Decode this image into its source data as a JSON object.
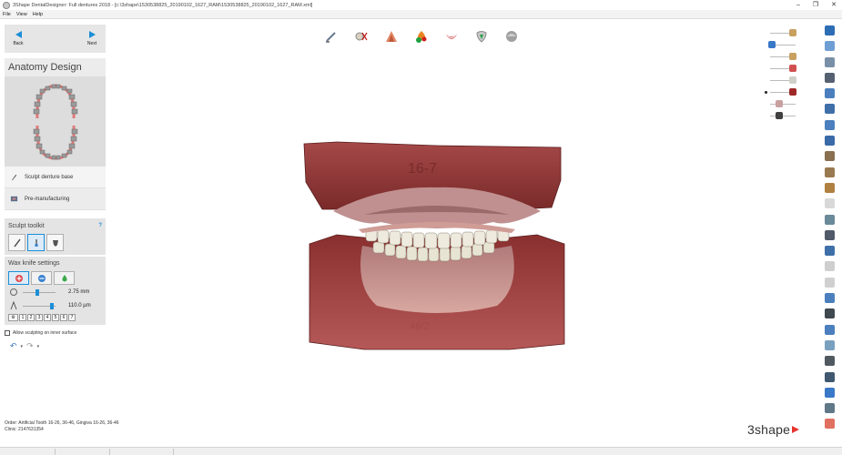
{
  "window": {
    "title": "3Shape DentalDesigner: Full dentures 2018 - [c:\\3shape\\1530538825_20190102_1627_RAM\\1530538825_20190102_1627_RAM.xml]",
    "controls": [
      "–",
      "❐",
      "✕"
    ]
  },
  "menu": {
    "items": [
      "File",
      "View",
      "Help"
    ]
  },
  "nav": {
    "back_label": "Back",
    "next_label": "Next"
  },
  "panel": {
    "title": "Anatomy Design",
    "steps": [
      {
        "label": "Sculpt denture base",
        "icon": "wax-knife-icon"
      },
      {
        "label": "Pre-manufacturing",
        "icon": "machine-icon"
      }
    ]
  },
  "toolkit": {
    "title": "Sculpt toolkit",
    "help": "?",
    "tools": [
      "wax-knife",
      "smooth-tool",
      "shape-tool"
    ],
    "active_tool": 1
  },
  "wax": {
    "title": "Wax knife settings",
    "modes": [
      "add-material",
      "remove-material",
      "smooth-material"
    ],
    "active_mode": 0,
    "radius": {
      "value": "2.75 mm",
      "fraction": 0.45
    },
    "amount": {
      "value": "110.0 µm",
      "fraction": 0.95
    },
    "presets": [
      "1",
      "2",
      "3",
      "4",
      "5",
      "6",
      "7"
    ]
  },
  "allow_inner": {
    "label": "Allow sculpting on inner surface",
    "checked": false
  },
  "history": {
    "undo": "↶",
    "redo": "↷",
    "caret": "▾"
  },
  "top_tools": [
    "sculpt-brush-icon",
    "tooth-cut-icon",
    "articulator-icon",
    "gingiva-color-icon",
    "lower-arch-icon",
    "tooth-crown-icon",
    "sphere-shading-icon"
  ],
  "layer_sliders": [
    {
      "color": "#c8a060",
      "fraction": 0.95
    },
    {
      "color": "#3a78c8",
      "fraction": 0.0
    },
    {
      "color": "#c8a060",
      "fraction": 0.95
    },
    {
      "color": "#d05050",
      "fraction": 0.95
    },
    {
      "color": "#d0d0c8",
      "fraction": 0.95
    },
    {
      "color": "#a02828",
      "fraction": 0.95
    },
    {
      "color": "#c8a0a0",
      "fraction": 0.35
    },
    {
      "color": "#404040",
      "fraction": 0.35
    }
  ],
  "right_toolbar": {
    "colors": [
      "#2d6db5",
      "#6f9ed4",
      "#7a8fa8",
      "#556070",
      "#4b7fbd",
      "#3e6fa8",
      "#4b7fbd",
      "#3a6aa8",
      "#8a7050",
      "#9a7a50",
      "#b08040",
      "#d8d8d8",
      "#6a8a9a",
      "#505a68",
      "#3e6fa8",
      "#cfcfcf",
      "#d0d0d0",
      "#4b7fbd",
      "#404850",
      "#4b7fbd",
      "#7aa0c0",
      "#505860",
      "#405870",
      "#3a78c8",
      "#607888",
      "#e07060"
    ]
  },
  "footer": {
    "order_label": "Order:",
    "order_value": "Artificial Tooth 16-26, 36-46, Gingiva 16-26, 36-46",
    "clinic_label": "Clinic:",
    "clinic_value": "2147631354"
  },
  "logo": {
    "text": "3shape"
  }
}
